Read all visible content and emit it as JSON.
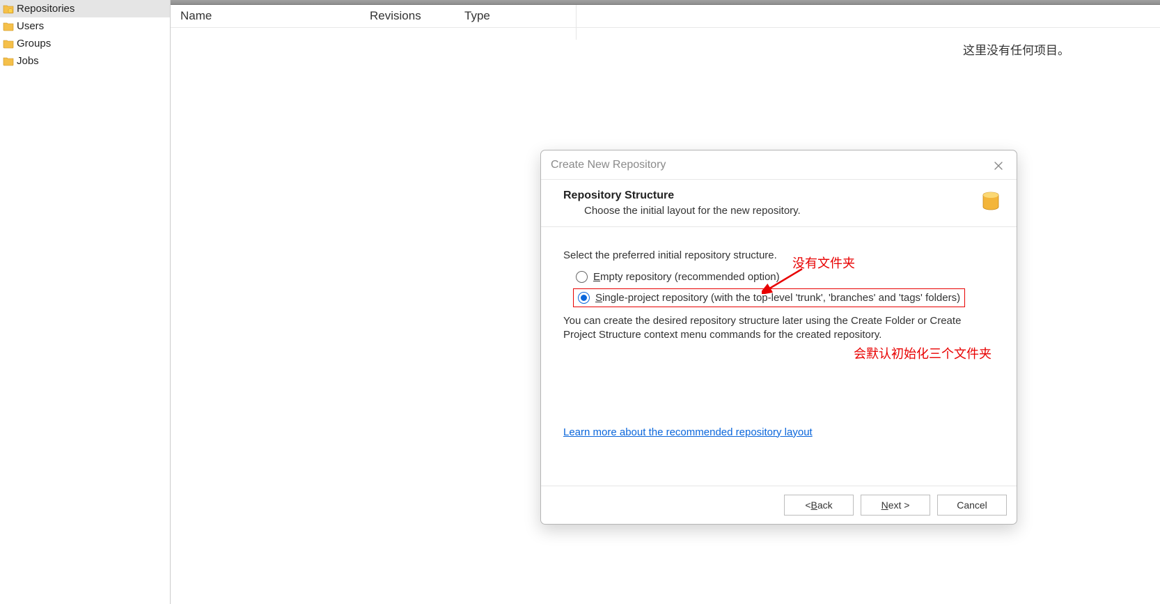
{
  "sidebar": {
    "items": [
      {
        "label": "Repositories",
        "selected": true,
        "icon": "db-folder"
      },
      {
        "label": "Users",
        "selected": false,
        "icon": "folder"
      },
      {
        "label": "Groups",
        "selected": false,
        "icon": "folder"
      },
      {
        "label": "Jobs",
        "selected": false,
        "icon": "folder"
      }
    ]
  },
  "main": {
    "columns": {
      "name": "Name",
      "revisions": "Revisions",
      "type": "Type"
    },
    "empty_text": "这里没有任何项目。"
  },
  "dialog": {
    "title": "Create New Repository",
    "header_title": "Repository Structure",
    "header_sub": "Choose the initial layout for the new repository.",
    "intro": "Select the preferred initial repository structure.",
    "option_empty_pre": "E",
    "option_empty_rest": "mpty repository (recommended option)",
    "option_single_pre": "S",
    "option_single_rest": "ingle-project repository (with the top-level 'trunk', 'branches' and 'tags' folders)",
    "note": "You can create the desired repository structure later using the Create Folder or Create Project Structure context menu commands for the created repository.",
    "link": "Learn more about the recommended repository layout",
    "btn_back_lt": "< ",
    "btn_back_pre": "B",
    "btn_back_rest": "ack",
    "btn_next_pre": "N",
    "btn_next_rest": "ext >",
    "btn_cancel": "Cancel"
  },
  "annotations": {
    "no_folder": "没有文件夹",
    "default_init": "会默认初始化三个文件夹"
  }
}
